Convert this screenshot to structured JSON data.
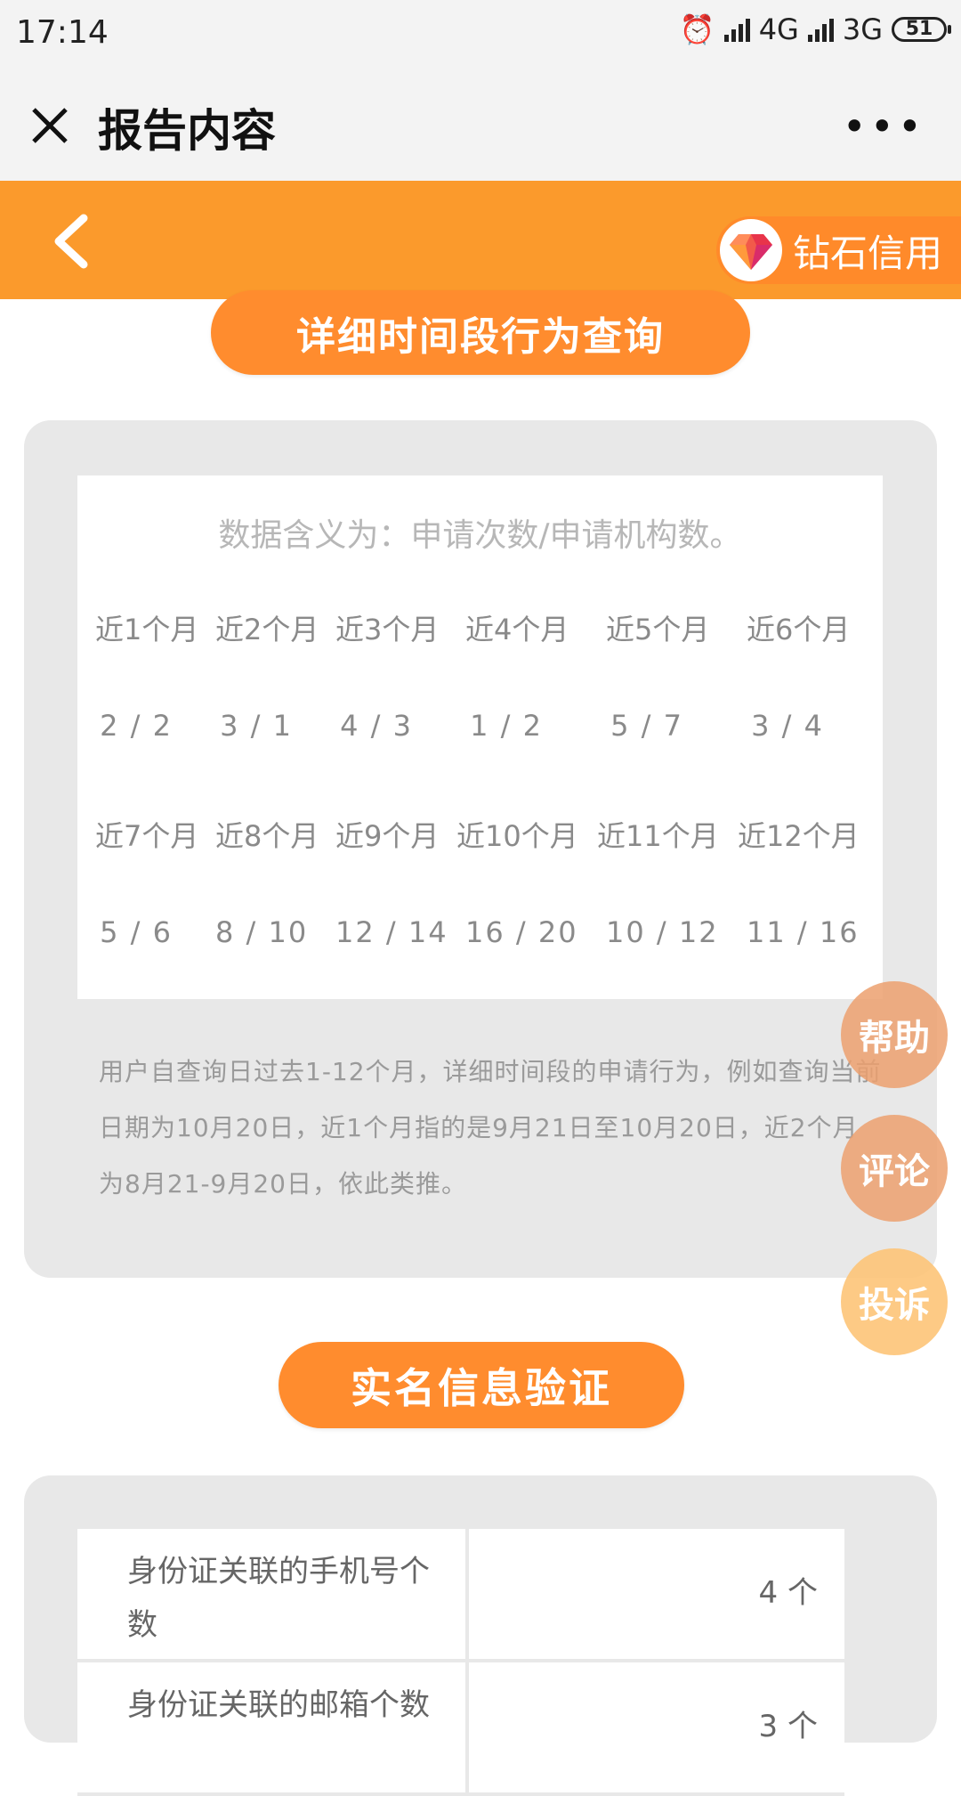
{
  "status_bar": {
    "time": "17:14",
    "network1": "4G",
    "network2": "3G",
    "battery": "51"
  },
  "title_bar": {
    "title": "报告内容",
    "more": "•••"
  },
  "header": {
    "brand_label": "钻石信用"
  },
  "section1": {
    "title": "详细时间段行为查询",
    "note": "数据含义为：申请次数/申请机构数。",
    "row1_labels": [
      "近1个月",
      "近2个月",
      "近3个月",
      "近4个月",
      "近5个月",
      "近6个月"
    ],
    "row1_values": [
      "2 / 2",
      "3 / 1",
      "4 / 3",
      "1 / 2",
      "5 / 7",
      "3 / 4"
    ],
    "row2_labels": [
      "近7个月",
      "近8个月",
      "近9个月",
      "近10个月",
      "近11个月",
      "近12个月"
    ],
    "row2_values": [
      "5 / 6",
      "8 / 10",
      "12 / 14",
      "16 / 20",
      "10 / 12",
      "11 / 16"
    ],
    "description": "用户自查询日过去1-12个月，详细时间段的申请行为，例如查询当前日期为10月20日，近1个月指的是9月21日至10月20日，近2个月为8月21-9月20日，依此类推。"
  },
  "floating_buttons": {
    "help": "帮助",
    "comment": "评论",
    "complaint": "投诉"
  },
  "section2": {
    "title": "实名信息验证",
    "rows": [
      {
        "label": "身份证关联的手机号个数",
        "value": "4 个"
      },
      {
        "label": "身份证关联的邮箱个数",
        "value": "3 个"
      }
    ]
  },
  "colors": {
    "orange": "#fb9a2c",
    "pill": "#ff8c2e",
    "card_bg": "#e8e8e8"
  },
  "icons": [
    "close-icon",
    "more-icon",
    "back-icon",
    "diamond-icon"
  ]
}
